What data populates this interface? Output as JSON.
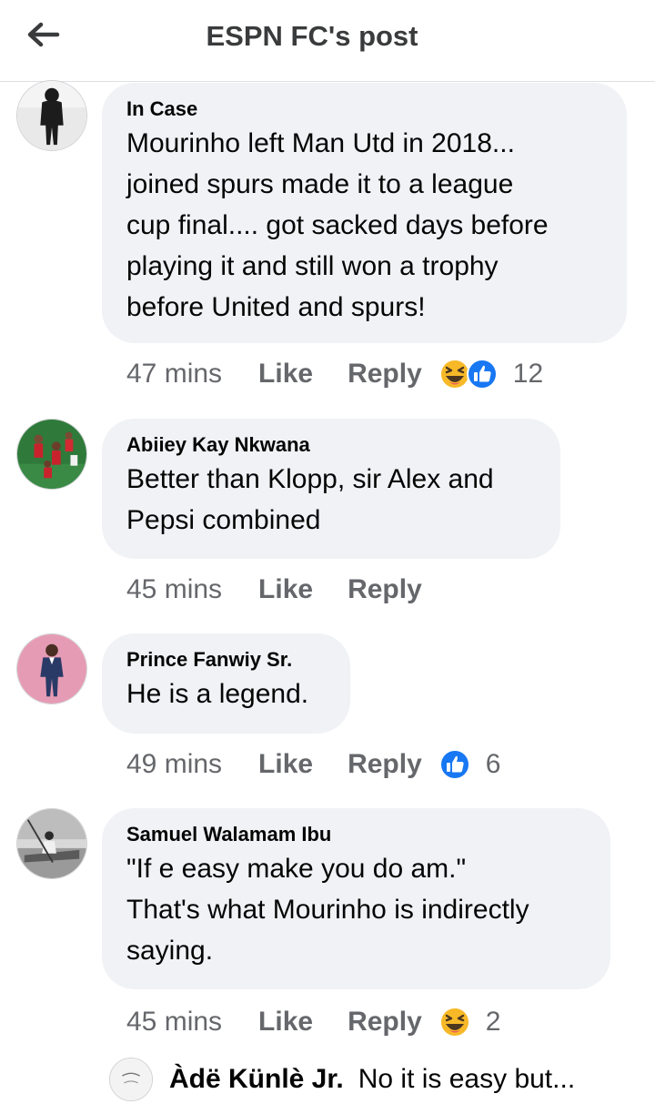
{
  "header": {
    "title": "ESPN FC's post"
  },
  "comments": [
    {
      "author": "In Case",
      "text": "Mourinho left Man Utd in 2018...\njoined spurs made it to a league\ncup final.... got sacked days before\nplaying it and still won a trophy\nbefore United and spurs!",
      "time": "47 mins",
      "like": "Like",
      "reply": "Reply",
      "reactions": [
        "haha-icon",
        "like-icon"
      ],
      "count": "12"
    },
    {
      "author": "Abiiey Kay Nkwana",
      "text": "Better than Klopp, sir Alex and\nPepsi combined",
      "time": "45 mins",
      "like": "Like",
      "reply": "Reply"
    },
    {
      "author": "Prince Fanwiy Sr.",
      "text": "He is a legend.",
      "time": "49 mins",
      "like": "Like",
      "reply": "Reply",
      "reactions": [
        "like-icon"
      ],
      "count": "6"
    },
    {
      "author": "Samuel Walamam Ibu",
      "text": "\"If e easy make you do am.\"\nThat's what Mourinho is indirectly\nsaying.",
      "time": "45 mins",
      "like": "Like",
      "reply": "Reply",
      "reactions": [
        "haha-icon"
      ],
      "count": "2"
    }
  ],
  "reply_preview": {
    "author": "Àdë Künlè Jr.",
    "text": "No it is easy but..."
  },
  "colors": {
    "bubble": "#f0f2f5",
    "meta_text": "#65676b",
    "like_blue": "#1877f2",
    "haha_yellow": "#f7b928"
  }
}
